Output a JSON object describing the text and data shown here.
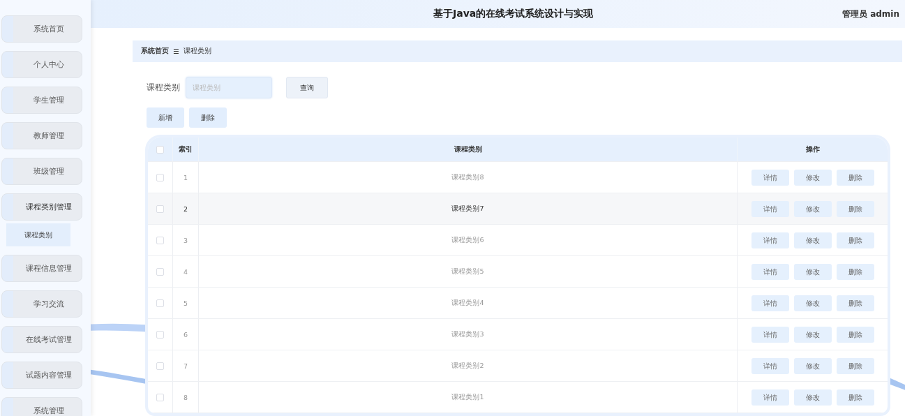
{
  "header": {
    "title": "基于Java的在线考试系统设计与实现",
    "user": "管理员 admin"
  },
  "sidebar": {
    "items": [
      {
        "label": "系统首页",
        "expanded": false
      },
      {
        "label": "个人中心",
        "expanded": false
      },
      {
        "label": "学生管理",
        "expanded": false
      },
      {
        "label": "教师管理",
        "expanded": false
      },
      {
        "label": "班级管理",
        "expanded": false
      },
      {
        "label": "课程类别管理",
        "expanded": true,
        "children": [
          {
            "label": "课程类别",
            "selected": true
          }
        ]
      },
      {
        "label": "课程信息管理",
        "expanded": false
      },
      {
        "label": "学习交流",
        "expanded": false
      },
      {
        "label": "在线考试管理",
        "expanded": false
      },
      {
        "label": "试题内容管理",
        "expanded": false
      },
      {
        "label": "系统管理",
        "expanded": false
      }
    ]
  },
  "breadcrumb": {
    "home": "系统首页",
    "separator": "☰",
    "current": "课程类别"
  },
  "search": {
    "label": "课程类别",
    "placeholder": "课程类别",
    "button": "查询"
  },
  "actions": [
    "新增",
    "删除"
  ],
  "table": {
    "columns": [
      "索引",
      "课程类别",
      "操作"
    ],
    "all_checked": false,
    "rows": [
      {
        "index": "1",
        "category": "课程类别8",
        "checked": false,
        "highlighted": false,
        "buttons": [
          "详情",
          "修改",
          "删除"
        ]
      },
      {
        "index": "2",
        "category": "课程类别7",
        "checked": false,
        "highlighted": true,
        "buttons": [
          "详情",
          "修改",
          "删除"
        ]
      },
      {
        "index": "3",
        "category": "课程类别6",
        "checked": false,
        "highlighted": false,
        "buttons": [
          "详情",
          "修改",
          "删除"
        ]
      },
      {
        "index": "4",
        "category": "课程类别5",
        "checked": false,
        "highlighted": false,
        "buttons": [
          "详情",
          "修改",
          "删除"
        ]
      },
      {
        "index": "5",
        "category": "课程类别4",
        "checked": false,
        "highlighted": false,
        "buttons": [
          "详情",
          "修改",
          "删除"
        ]
      },
      {
        "index": "6",
        "category": "课程类别3",
        "checked": false,
        "highlighted": false,
        "buttons": [
          "详情",
          "修改",
          "删除"
        ]
      },
      {
        "index": "7",
        "category": "课程类别2",
        "checked": false,
        "highlighted": false,
        "buttons": [
          "详情",
          "修改",
          "删除"
        ]
      },
      {
        "index": "8",
        "category": "课程类别1",
        "checked": false,
        "highlighted": false,
        "buttons": [
          "详情",
          "修改",
          "删除"
        ]
      }
    ]
  }
}
